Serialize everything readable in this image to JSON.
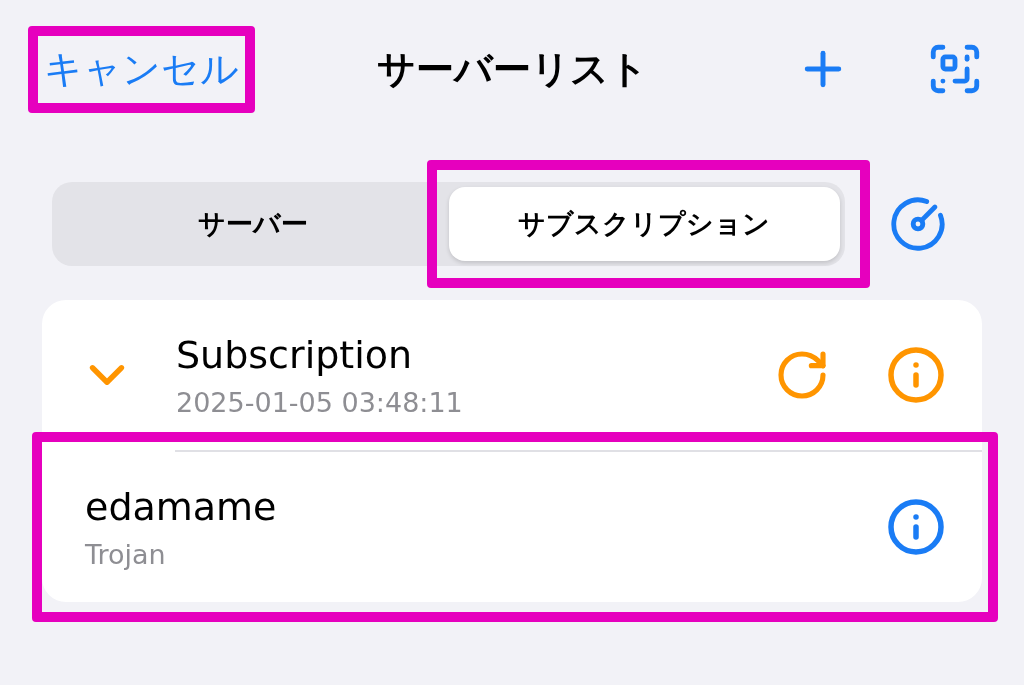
{
  "header": {
    "cancel": {
      "label": "キャンセル",
      "highlighted": true
    },
    "title": "サーバーリスト"
  },
  "tabs": [
    {
      "label": "サーバー",
      "selected": false,
      "highlighted": false
    },
    {
      "label": "サブスクリプション",
      "selected": true,
      "highlighted": true
    }
  ],
  "groups": [
    {
      "name": "Subscription",
      "updated": "2025-01-05 03:48:11",
      "expanded": true,
      "servers": [
        {
          "name": "edamame",
          "protocol": "Trojan",
          "highlighted": true
        }
      ]
    }
  ]
}
